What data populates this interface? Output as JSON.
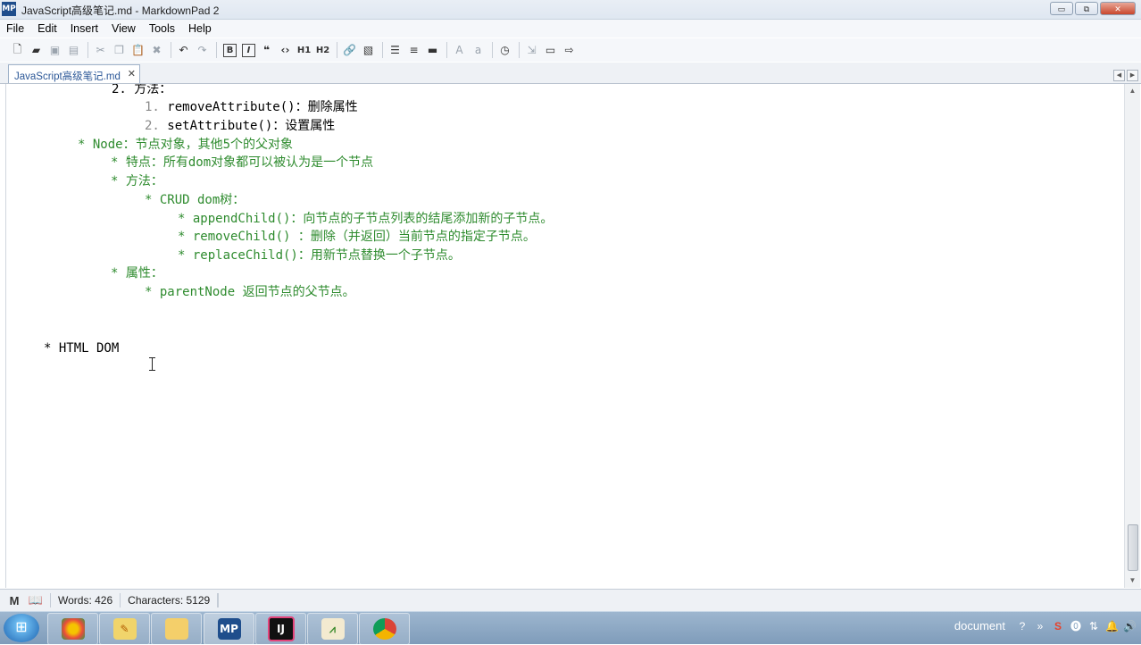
{
  "window": {
    "app_icon": "MP",
    "title": "JavaScript高级笔记.md - MarkdownPad 2",
    "minimize": "▭",
    "maximize": "⧉",
    "close": "✕"
  },
  "menu": [
    "File",
    "Edit",
    "Insert",
    "View",
    "Tools",
    "Help"
  ],
  "toolbar": {
    "icons": [
      "new-document-icon",
      "open-folder-icon",
      "save-icon",
      "save-all-icon",
      "cut-icon",
      "copy-icon",
      "paste-icon",
      "delete-icon",
      "undo-icon",
      "redo-icon",
      "bold-icon",
      "italic-icon",
      "quote-icon",
      "code-icon",
      "heading1-icon",
      "heading2-icon",
      "link-icon",
      "image-icon",
      "unordered-list-icon",
      "ordered-list-icon",
      "horizontal-rule-icon",
      "uppercase-icon",
      "lowercase-icon",
      "timestamp-icon",
      "preview-icon",
      "browser-preview-icon",
      "export-icon"
    ],
    "h1": "H1",
    "h2": "H2",
    "bold": "B",
    "italic": "I"
  },
  "tab": {
    "label": "JavaScript高级笔记.md",
    "close": "✕"
  },
  "editor": {
    "lines": [
      "2. 方法：",
      "1. ",
      "removeAttribute()：删除属性",
      "2. ",
      "setAttribute()：设置属性",
      "* Node：节点对象，其他5个的父对象",
      "* 特点：所有dom对象都可以被认为是一个节点",
      "* 方法：",
      "* CRUD dom树：",
      "* appendChild()：向节点的子节点列表的结尾添加新的子节点。",
      "* removeChild() ：删除（并返回）当前节点的指定子节点。",
      "* replaceChild()：用新节点替换一个子节点。",
      "* 属性：",
      "* parentNode 返回节点的父节点。",
      "* HTML DOM"
    ]
  },
  "status": {
    "words": "Words: 426",
    "characters": "Characters: 5129"
  },
  "taskbar": {
    "apps": [
      "start-orb",
      "chrome-colors",
      "editor-pencil",
      "file-explorer",
      "MP",
      "IJ",
      "notepad-chart",
      "chrome"
    ],
    "mp_label": "MP",
    "ij_label": "IJ",
    "tray_text": "document"
  },
  "colors": {
    "green_text": "#2e8b2e",
    "tab_text": "#2b5797",
    "taskbar": "#8aa6c3"
  }
}
